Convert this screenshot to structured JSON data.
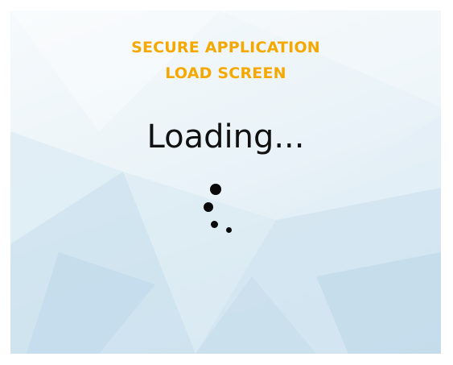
{
  "screen": {
    "title_line1": "SECURE APPLICATION",
    "title_line2": "LOAD SCREEN",
    "loading_text": "Loading...",
    "accent_color": "#f5a800",
    "spinner_icon": "loading-spinner-icon"
  }
}
